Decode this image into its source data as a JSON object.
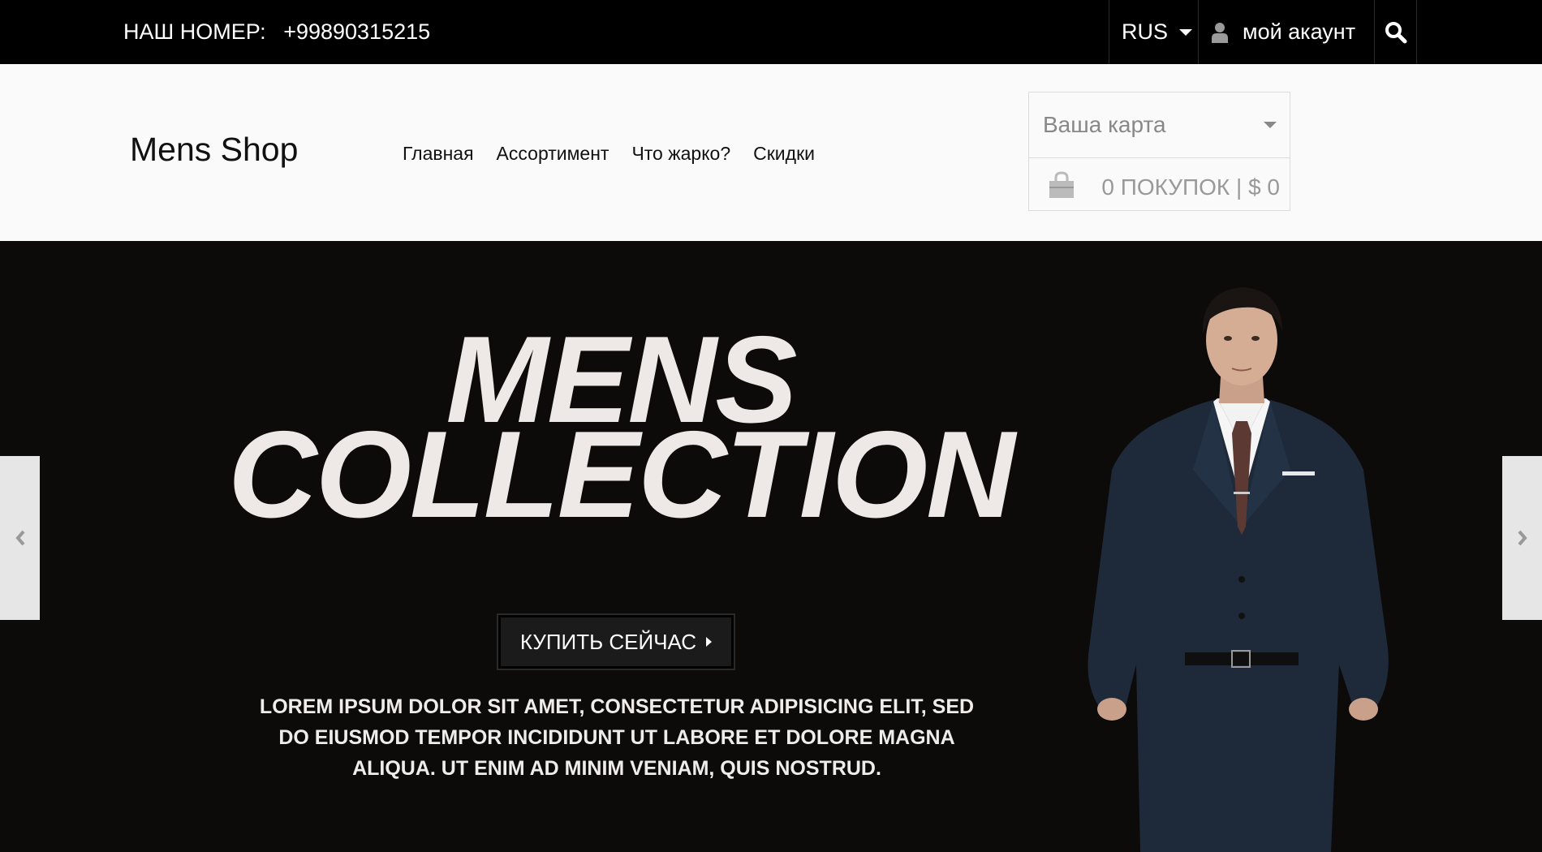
{
  "topbar": {
    "phone_label": "НАШ НОМЕР:",
    "phone_number": "+99890315215",
    "language": "RUS",
    "account": "мой акаунт"
  },
  "header": {
    "logo": "Mens Shop",
    "nav": [
      "Главная",
      "Ассортимент",
      "Что жарко?",
      "Скидки"
    ],
    "cart": {
      "placeholder": "Ваша карта",
      "summary": "0 ПОКУПОК | $ 0"
    }
  },
  "hero": {
    "title_line1": "MENS",
    "title_line2": "COLLECTION",
    "button": "КУПИТЬ СЕЙЧАС",
    "description": "LOREM IPSUM DOLOR SIT AMET, CONSECTETUR ADIPISICING ELIT, SED DO EIUSMOD TEMPOR INCIDIDUNT UT LABORE ET DOLORE MAGNA ALIQUA. UT ENIM AD MINIM VENIAM, QUIS NOSTRUD."
  },
  "colors": {
    "topbar_bg": "#000000",
    "header_bg": "#fafafa",
    "hero_bg": "#0d0b0a",
    "hero_text": "#eee8e6"
  },
  "icons": [
    "caret-down-icon",
    "user-icon",
    "search-icon",
    "shopping-bag-icon",
    "chevron-left-icon",
    "chevron-right-icon"
  ]
}
